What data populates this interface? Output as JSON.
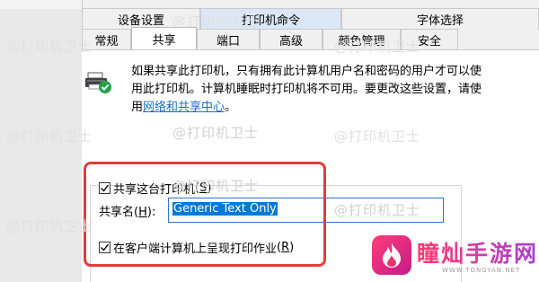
{
  "tabs_row1": [
    "设备设置",
    "打印机命令",
    "字体选择"
  ],
  "tabs_row2": [
    "常规",
    "共享",
    "端口",
    "高级",
    "颜色管理",
    "安全"
  ],
  "info": {
    "text": "如果共享此打印机，只有拥有此计算机用户名和密码的用户才可以使用此打印机。计算机睡眠时打印机将不可用。要更改这些设置，请使用",
    "link": "网络和共享中心",
    "end": "。"
  },
  "share_checkbox": {
    "label": "共享这台打印机",
    "hotkey_open": "(",
    "hotkey": "S",
    "hotkey_close": ")",
    "checked": true
  },
  "share_name": {
    "label": "共享名",
    "hotkey_open": "(",
    "hotkey": "H",
    "hotkey_close": "):",
    "value": "Generic  Text Only"
  },
  "render_checkbox": {
    "label": "在客户端计算机上呈现打印作业",
    "hotkey_open": "(",
    "hotkey": "R",
    "hotkey_close": ")",
    "checked": true
  },
  "watermark": "@打印机卫士",
  "logo": {
    "title": "瞳灿手游网",
    "subtitle": "WWW.TONGYAN.NET"
  },
  "colors": {
    "accent": "#0078d7",
    "link": "#1a6fc2",
    "highlight_box": "#e53b3b",
    "tab_hover": "#dbe7f5"
  }
}
